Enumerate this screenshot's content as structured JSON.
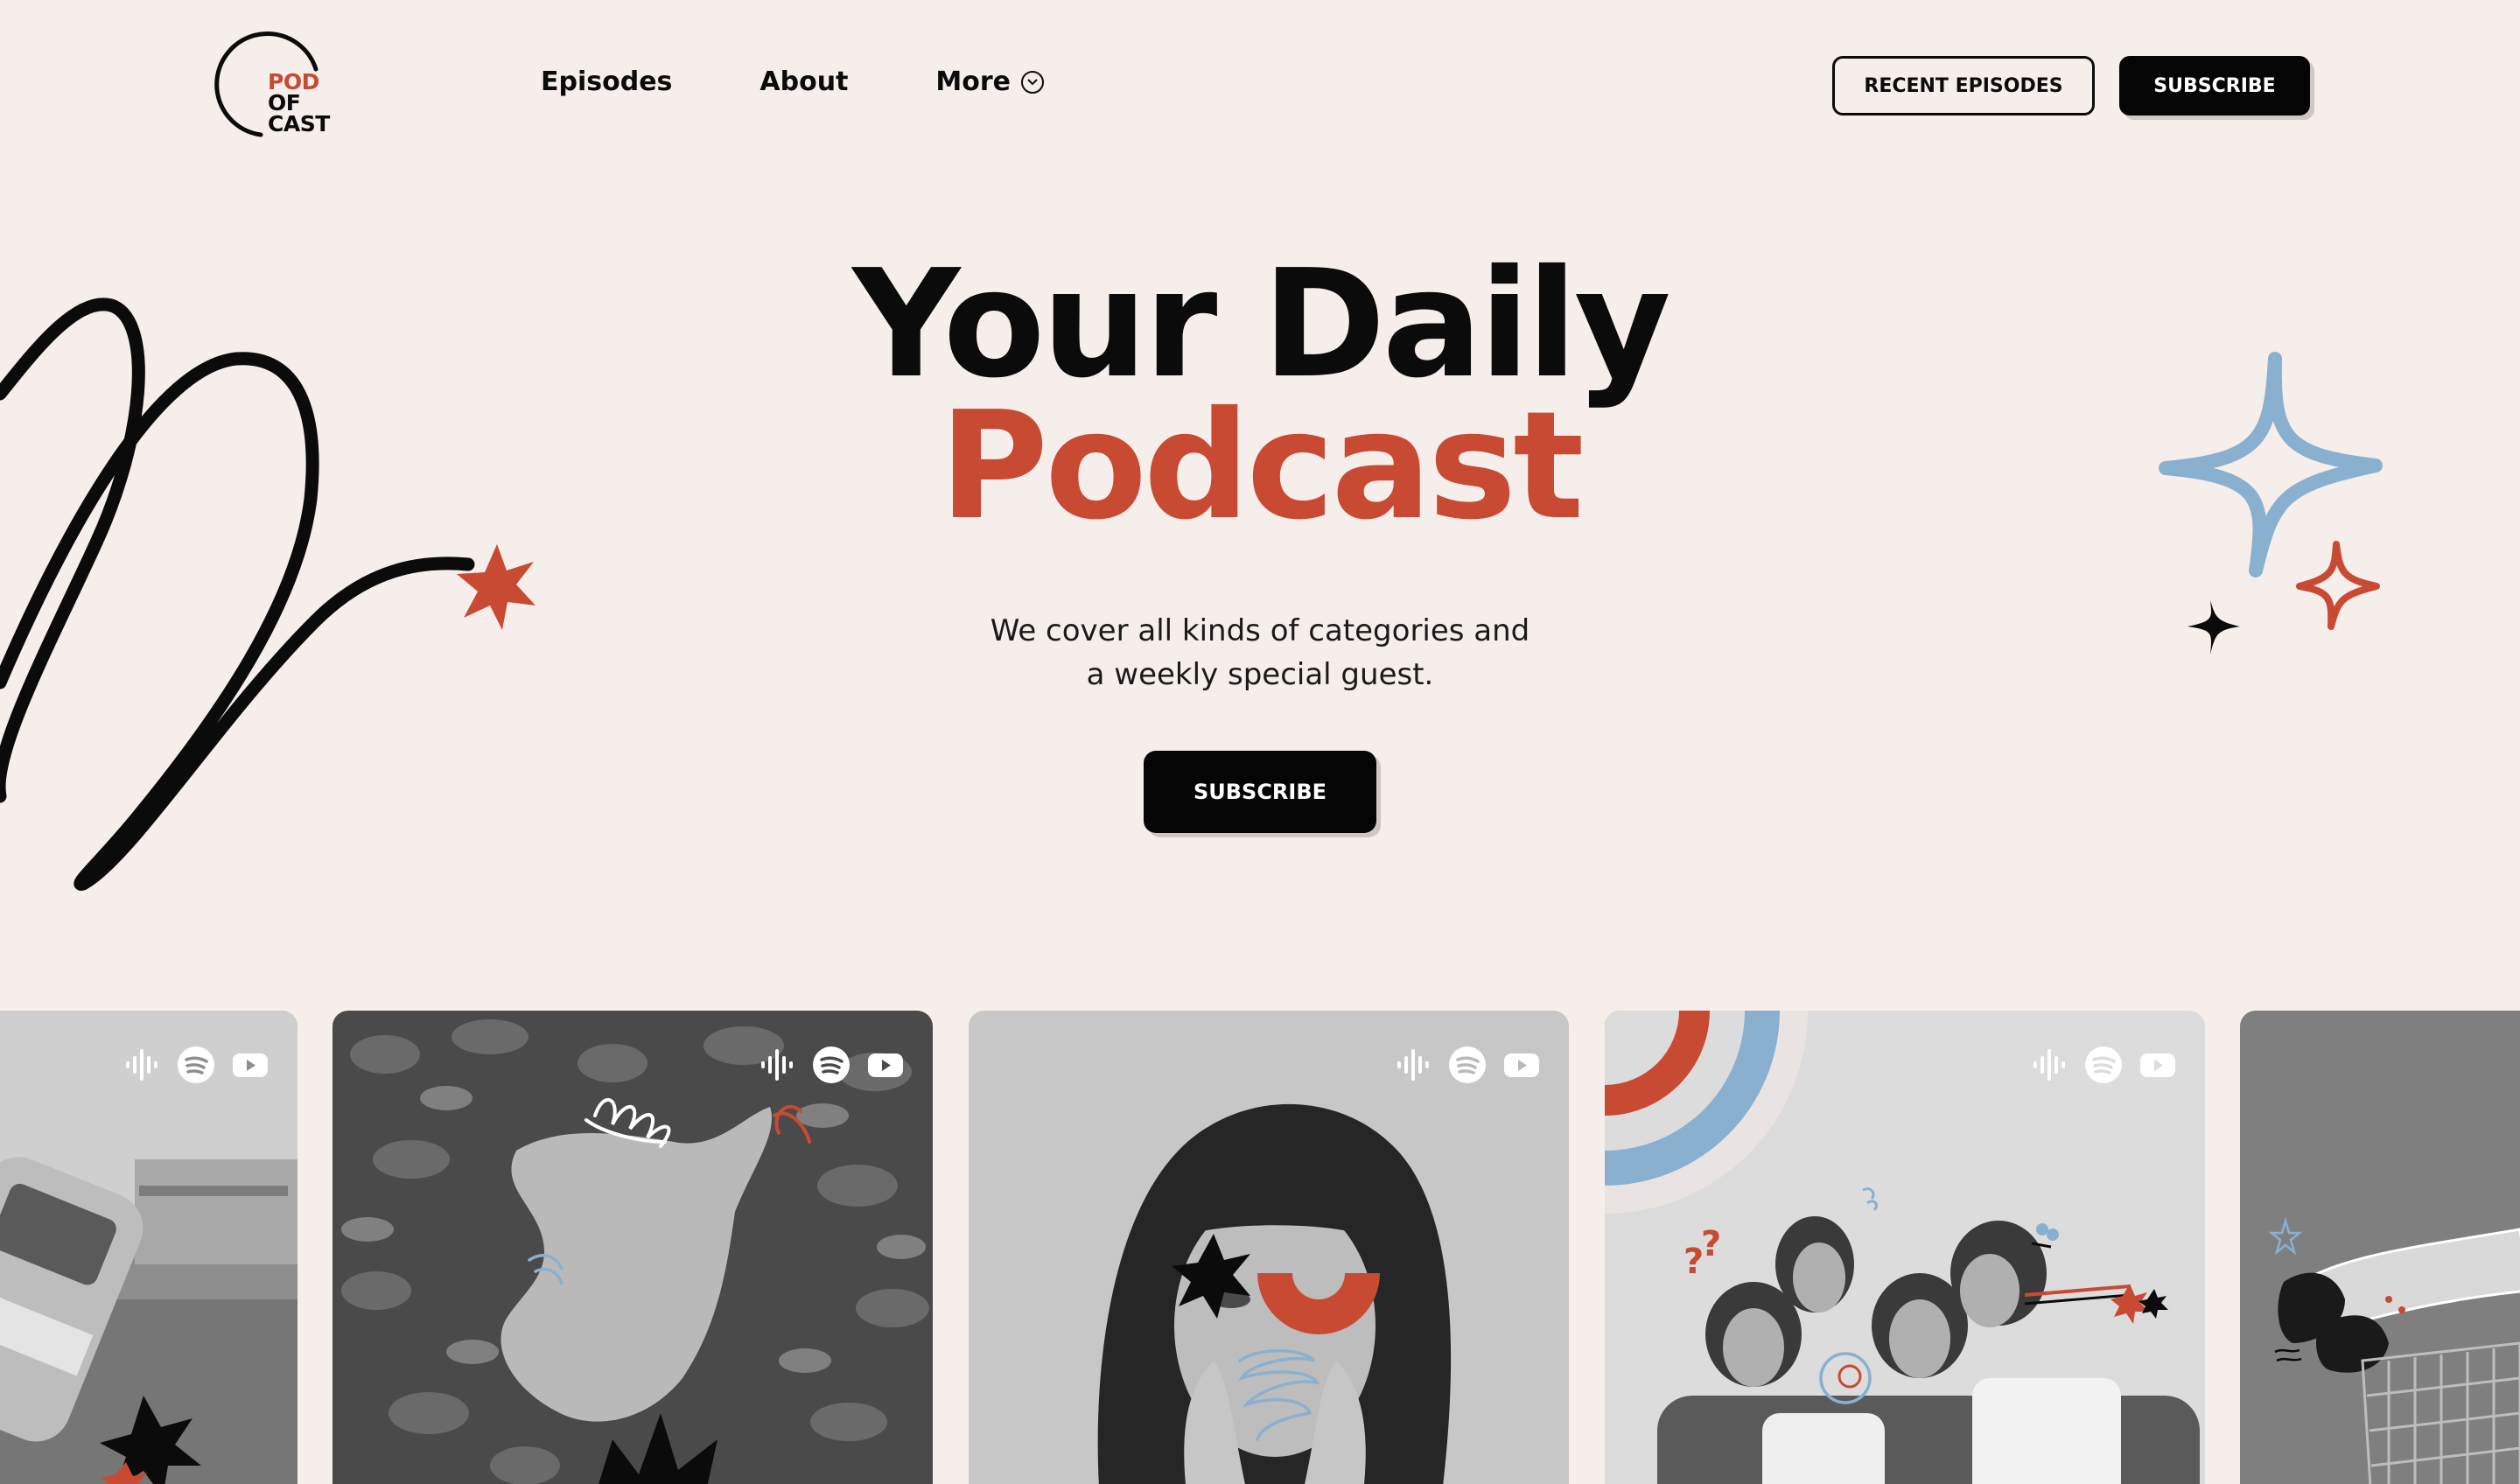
{
  "logo": {
    "line1": "POD",
    "line2": "OF",
    "line3": "CAST"
  },
  "nav": {
    "items": [
      {
        "label": "Episodes"
      },
      {
        "label": "About"
      },
      {
        "label": "More"
      }
    ]
  },
  "header": {
    "recent_label": "RECENT EPISODES",
    "subscribe_label": "SUBSCRIBE"
  },
  "hero": {
    "title_line1": "Your Daily",
    "title_line2": "Podcast",
    "subtitle_line1": "We cover all kinds of categories and",
    "subtitle_line2": "a weekly special guest.",
    "cta_label": "SUBSCRIBE"
  },
  "colors": {
    "background": "#f6eeea",
    "accent_red": "#c94a33",
    "accent_blue": "#8ab0d0",
    "ink": "#0b0b0b"
  },
  "cards": {
    "platform_icons": [
      "podcast-icon",
      "spotify-icon",
      "youtube-icon"
    ],
    "items": [
      {
        "name": "van"
      },
      {
        "name": "bush"
      },
      {
        "name": "portrait"
      },
      {
        "name": "group"
      },
      {
        "name": "cart"
      }
    ]
  }
}
